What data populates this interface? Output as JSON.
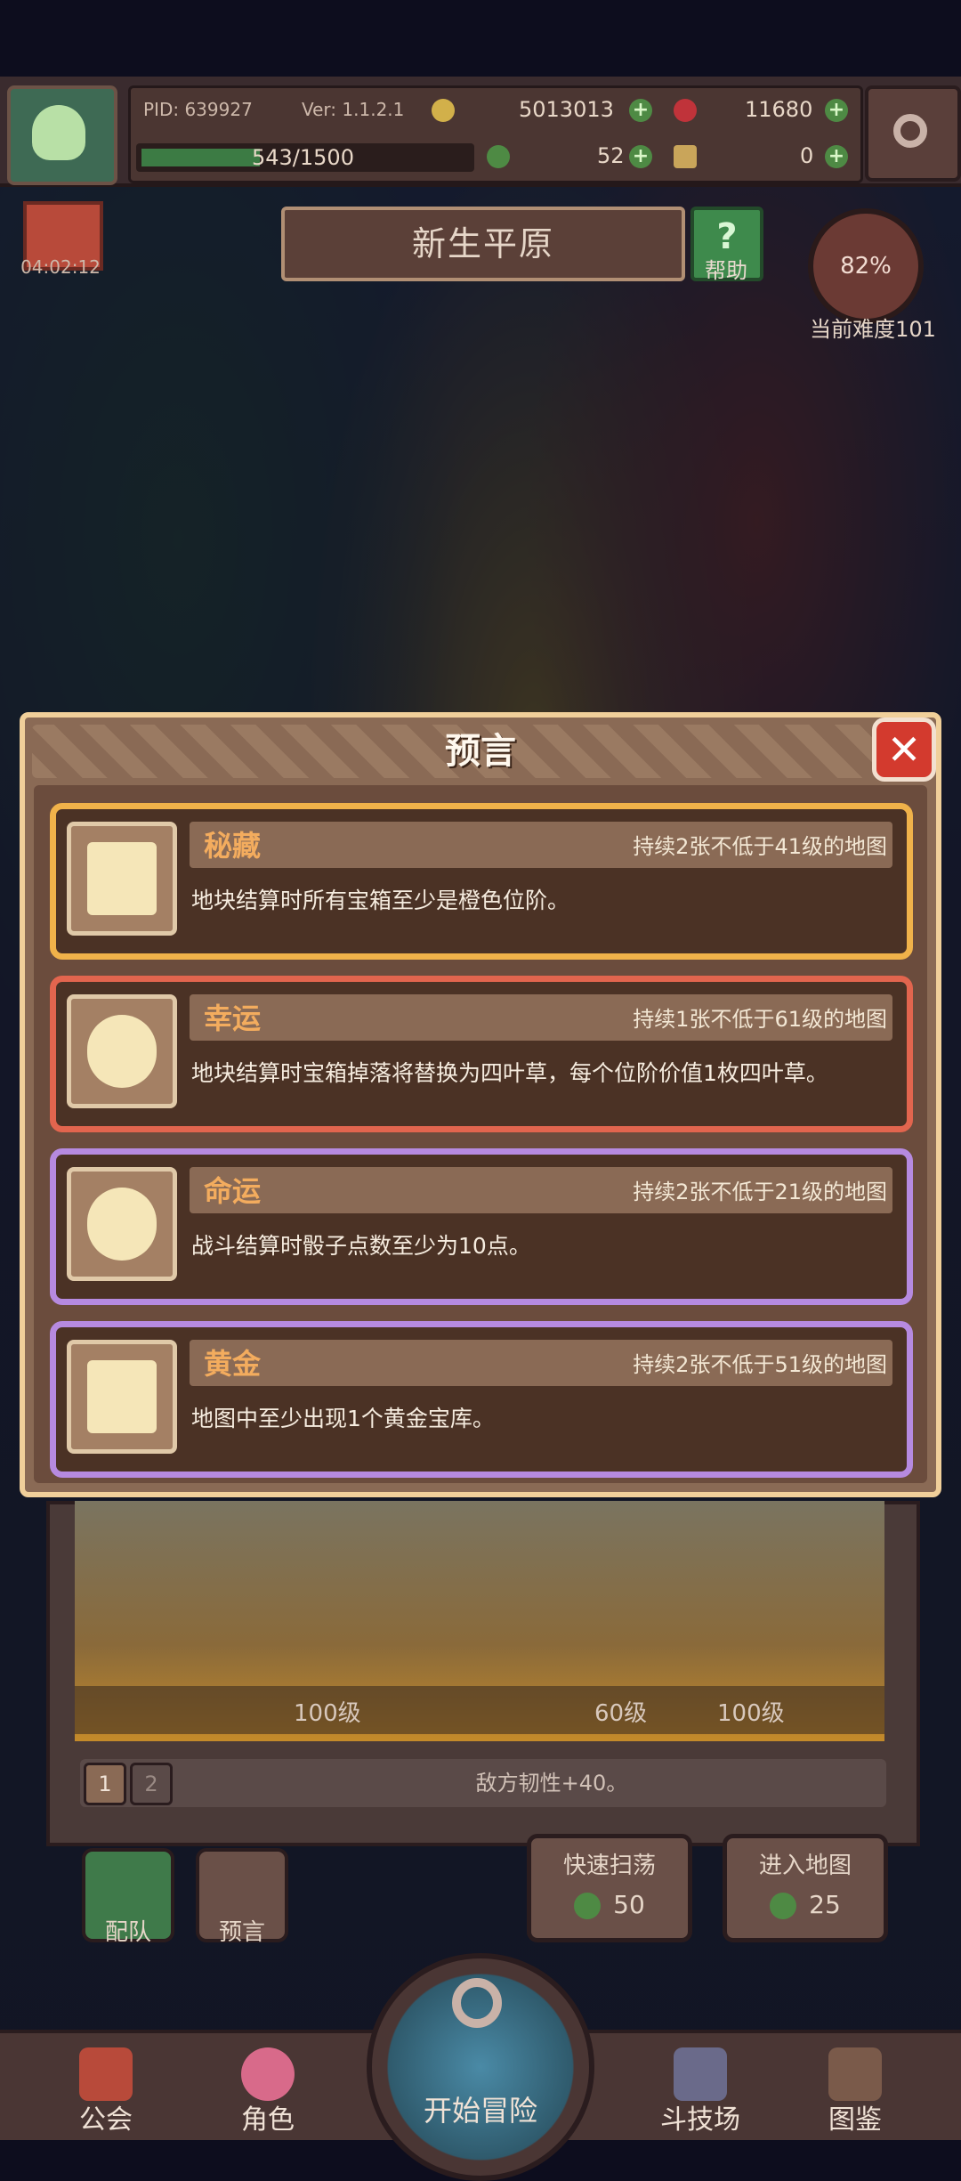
{
  "header": {
    "pid": "PID: 639927",
    "version": "Ver: 1.1.2.1",
    "gold": "5013013",
    "gems": "11680",
    "xp": "543/1500",
    "xp_fraction": 0.362,
    "clover": "52",
    "item": "0"
  },
  "map": {
    "title": "新生平原",
    "help_label": "帮助",
    "gift_timer": "04:02:12",
    "difficulty_percent": "82%",
    "difficulty_label": "当前难度101"
  },
  "prophecy_modal": {
    "title": "预言",
    "cards": [
      {
        "name": "秘藏",
        "condition": "持续2张不低于41级的地图",
        "description": "地块结算时所有宝箱至少是橙色位阶。",
        "border_color": "#f0b24a"
      },
      {
        "name": "幸运",
        "condition": "持续1张不低于61级的地图",
        "description": "地块结算时宝箱掉落将替换为四叶草，每个位阶价值1枚四叶草。",
        "border_color": "#e2654e"
      },
      {
        "name": "命运",
        "condition": "持续2张不低于21级的地图",
        "description": "战斗结算时骰子点数至少为10点。",
        "border_color": "#b68ae0"
      },
      {
        "name": "黄金",
        "condition": "持续2张不低于51级的地图",
        "description": "地图中至少出现1个黄金宝库。",
        "border_color": "#b68ae0"
      }
    ]
  },
  "stage": {
    "level_left": "100级",
    "level_mid": "60级",
    "level_right": "100级",
    "page_1": "1",
    "page_2": "2",
    "enemy_bonus": "敌方韧性+40。"
  },
  "actions": {
    "team_label": "配队",
    "prophecy_label": "预言",
    "sweep_title": "快速扫荡",
    "sweep_cost": "50",
    "enter_title": "进入地图",
    "enter_cost": "25"
  },
  "nav": {
    "guild": "公会",
    "character": "角色",
    "start": "开始冒险",
    "arena": "斗技场",
    "codex": "图鉴"
  }
}
